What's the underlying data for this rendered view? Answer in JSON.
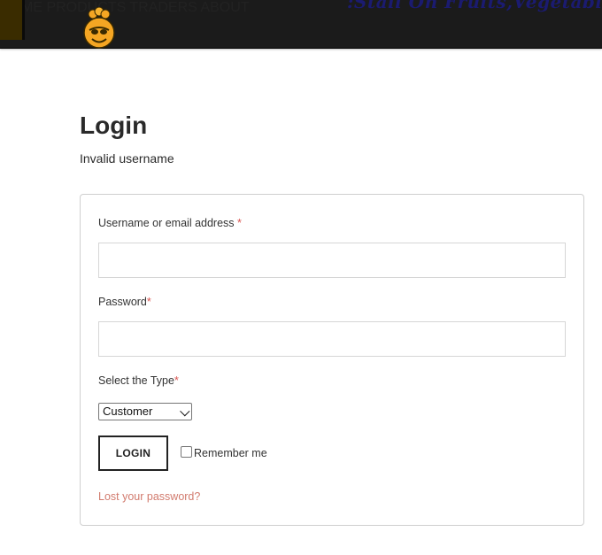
{
  "header": {
    "banner_text": ":Stall On Fruits,Vegetabl",
    "nav": [
      "HOME",
      "PRODUCTS",
      "TRADERS",
      "ABOUT"
    ]
  },
  "page": {
    "title": "Login",
    "notice": "Invalid username"
  },
  "form": {
    "username_label": "Username or email address",
    "username_required": "*",
    "username_value": "",
    "password_label": "Password",
    "password_required": "*",
    "password_value": "",
    "type_label": "Select the Type",
    "type_required": "*",
    "type_selected": "Customer",
    "login_button": "LOGIN",
    "remember_label": "Remember me",
    "remember_checked": false,
    "lost_password": "Lost your password?"
  },
  "colors": {
    "header_bg": "#1b1b1b",
    "required": "#d9534f",
    "link": "#d27b6e",
    "logo_yellow": "#f5a623"
  }
}
